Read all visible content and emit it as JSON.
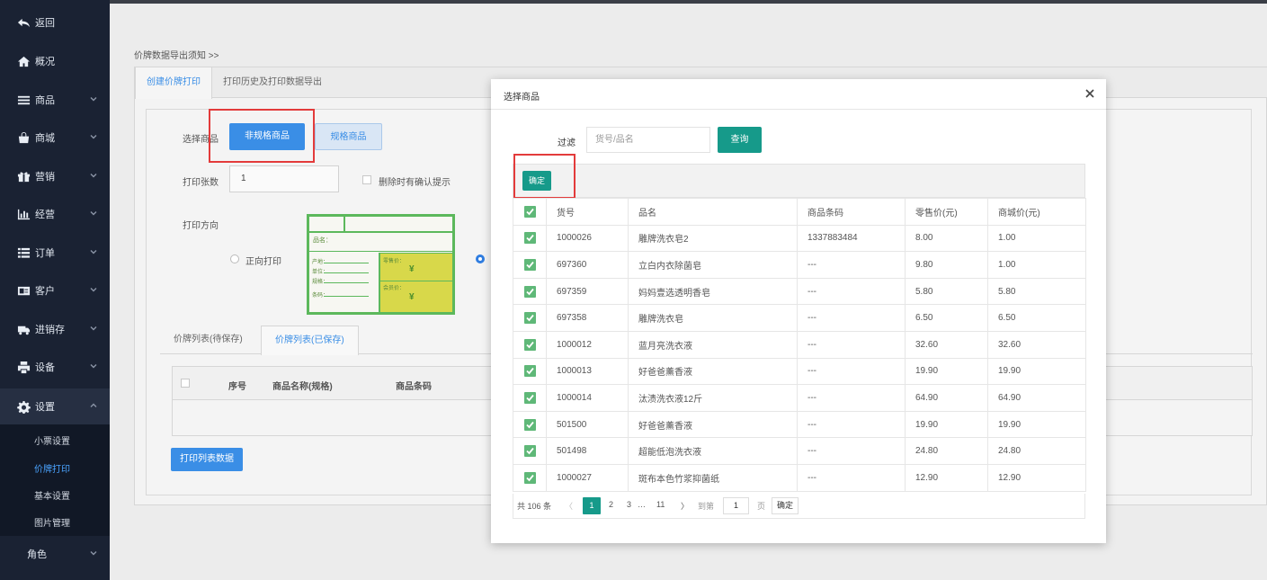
{
  "sidebar": {
    "items": [
      {
        "label": "返回",
        "icon": "back-arrow-icon"
      },
      {
        "label": "概况",
        "icon": "home-icon"
      },
      {
        "label": "商品",
        "icon": "menu-icon"
      },
      {
        "label": "商城",
        "icon": "shop-bag-icon"
      },
      {
        "label": "营销",
        "icon": "gift-icon"
      },
      {
        "label": "经营",
        "icon": "bar-chart-icon"
      },
      {
        "label": "订单",
        "icon": "list-icon"
      },
      {
        "label": "客户",
        "icon": "id-card-icon"
      },
      {
        "label": "进销存",
        "icon": "truck-icon"
      },
      {
        "label": "设备",
        "icon": "printer-icon"
      },
      {
        "label": "设置",
        "icon": "gear-icon"
      }
    ],
    "sub_items": [
      "小票设置",
      "价牌打印",
      "基本设置",
      "图片管理"
    ],
    "active_sub": "价牌打印",
    "role_label": "角色"
  },
  "main": {
    "notice": "价牌数据导出须知 >>",
    "tabs": [
      "创建价牌打印",
      "打印历史及打印数据导出"
    ],
    "select_goods_label": "选择商品",
    "btn_non_spec": "非规格商品",
    "btn_spec": "规格商品",
    "print_count_label": "打印张数",
    "print_count_value": "1",
    "confirm_delete_label": "删除时有确认提示",
    "print_direction_label": "打印方向",
    "forward_print_label": "正向打印",
    "tag_preview": {
      "name_label": "品名：",
      "retail_label": "零售价：",
      "member_label": "会员价：",
      "yuan": "¥",
      "field1": "产地：",
      "field2": "单位：",
      "field3": "规格：",
      "field4": "条码："
    },
    "list_tabs": [
      "价牌列表(待保存)",
      "价牌列表(已保存)"
    ],
    "list_columns": [
      "序号",
      "商品名称(规格)",
      "商品条码"
    ],
    "print_list_btn": "打印列表数据"
  },
  "modal": {
    "title": "选择商品",
    "filter_label": "过滤",
    "filter_placeholder": "货号/品名",
    "query_btn": "查询",
    "confirm_btn": "确定",
    "columns": [
      "货号",
      "品名",
      "商品条码",
      "零售价(元)",
      "商城价(元)"
    ],
    "rows": [
      [
        "1000026",
        "雕牌洗衣皂2",
        "1337883484",
        "8.00",
        "1.00"
      ],
      [
        "697360",
        "立白内衣除菌皂",
        "---",
        "9.80",
        "1.00"
      ],
      [
        "697359",
        "妈妈壹选透明香皂",
        "---",
        "5.80",
        "5.80"
      ],
      [
        "697358",
        "雕牌洗衣皂",
        "---",
        "6.50",
        "6.50"
      ],
      [
        "1000012",
        "蓝月亮洗衣液",
        "---",
        "32.60",
        "32.60"
      ],
      [
        "1000013",
        "好爸爸薰香液",
        "---",
        "19.90",
        "19.90"
      ],
      [
        "1000014",
        "汰渍洗衣液12斤",
        "---",
        "64.90",
        "64.90"
      ],
      [
        "501500",
        "好爸爸薰香液",
        "---",
        "19.90",
        "19.90"
      ],
      [
        "501498",
        "超能低泡洗衣液",
        "---",
        "24.80",
        "24.80"
      ],
      [
        "1000027",
        "斑布本色竹浆抑菌纸",
        "---",
        "12.90",
        "12.90"
      ]
    ],
    "pager": {
      "total": "共 106 条",
      "prev": "〈",
      "pages": [
        "1",
        "2",
        "3",
        "…",
        "11"
      ],
      "next": "〉",
      "goto_label": "到第",
      "goto_value": "1",
      "page_unit": "页",
      "goto_btn": "确定"
    }
  },
  "colors": {
    "sidebar_bg": "#1a2233",
    "primary_blue": "#3a8ee6",
    "teal": "#169a8a",
    "check_green": "#5fb878",
    "highlight_red": "#e33b3b"
  }
}
